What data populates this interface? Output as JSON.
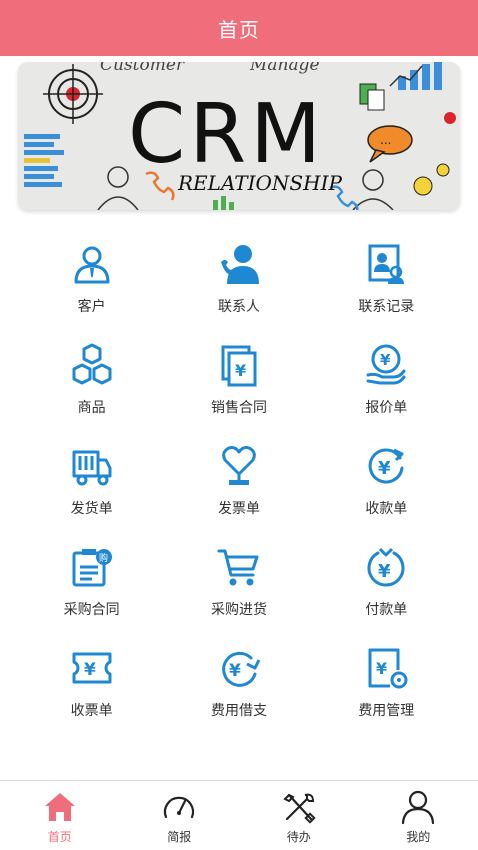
{
  "header": {
    "title": "首页"
  },
  "banner": {
    "main_text": "CRM",
    "sub_text": "RELATIONSHIP",
    "top_left_text": "Customer",
    "top_right_text": "Manage",
    "bubble_text": "..."
  },
  "grid": {
    "items": [
      {
        "label": "客户",
        "icon": "customer-icon"
      },
      {
        "label": "联系人",
        "icon": "contact-person-icon"
      },
      {
        "label": "联系记录",
        "icon": "contact-record-icon"
      },
      {
        "label": "商品",
        "icon": "goods-icon"
      },
      {
        "label": "销售合同",
        "icon": "sales-contract-icon"
      },
      {
        "label": "报价单",
        "icon": "quotation-icon"
      },
      {
        "label": "发货单",
        "icon": "delivery-truck-icon"
      },
      {
        "label": "发票单",
        "icon": "invoice-icon"
      },
      {
        "label": "收款单",
        "icon": "receipt-icon"
      },
      {
        "label": "采购合同",
        "icon": "purchase-contract-icon"
      },
      {
        "label": "采购进货",
        "icon": "shopping-cart-icon"
      },
      {
        "label": "付款单",
        "icon": "payment-icon"
      },
      {
        "label": "收票单",
        "icon": "ticket-icon"
      },
      {
        "label": "费用借支",
        "icon": "expense-loan-icon"
      },
      {
        "label": "费用管理",
        "icon": "expense-manage-icon"
      }
    ]
  },
  "tabbar": {
    "tabs": [
      {
        "label": "首页",
        "icon": "home-icon",
        "active": true
      },
      {
        "label": "简报",
        "icon": "speedometer-icon",
        "active": false
      },
      {
        "label": "待办",
        "icon": "tools-icon",
        "active": false
      },
      {
        "label": "我的",
        "icon": "user-icon",
        "active": false
      }
    ]
  },
  "colors": {
    "accent": "#f06e7c",
    "icon_blue": "#1e88d2",
    "text": "#333333"
  }
}
